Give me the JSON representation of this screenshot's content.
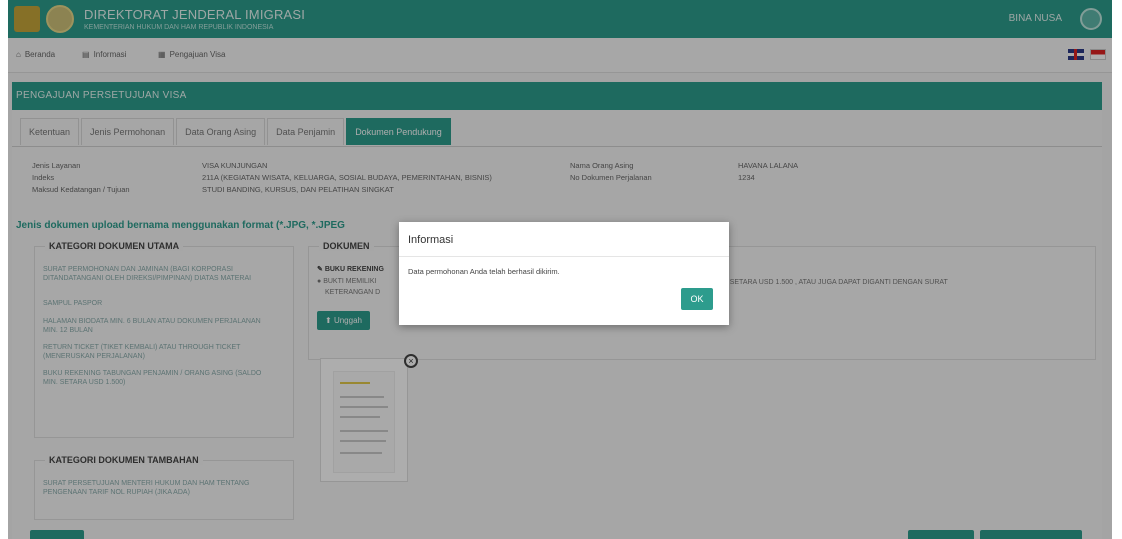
{
  "brand": {
    "title": "DIREKTORAT JENDERAL IMIGRASI",
    "subtitle": "KEMENTERIAN HUKUM DAN HAM REPUBLIK INDONESIA"
  },
  "user": {
    "name": "BINA NUSA"
  },
  "nav": [
    {
      "label": "Beranda",
      "icon": "home-icon"
    },
    {
      "label": "Informasi",
      "icon": "book-icon"
    },
    {
      "label": "Pengajuan Visa",
      "icon": "table-icon"
    }
  ],
  "panel": {
    "title": "PENGAJUAN PERSETUJUAN VISA"
  },
  "tabs": [
    {
      "label": "Ketentuan"
    },
    {
      "label": "Jenis Permohonan"
    },
    {
      "label": "Data Orang Asing"
    },
    {
      "label": "Data Penjamin"
    },
    {
      "label": "Dokumen Pendukung",
      "active": true
    }
  ],
  "info_left": {
    "labels": [
      "Jenis Layanan",
      "Indeks",
      "Maksud Kedatangan / Tujuan"
    ],
    "values": [
      "VISA KUNJUNGAN",
      "211A  (KEGIATAN WISATA, KELUARGA, SOSIAL BUDAYA, PEMERINTAHAN, BISNIS)",
      "STUDI BANDING, KURSUS, DAN PELATIHAN SINGKAT"
    ]
  },
  "info_right": {
    "labels": [
      "Nama Orang Asing",
      "No Dokumen Perjalanan"
    ],
    "values": [
      "HAVANA LALANA",
      "1234"
    ]
  },
  "note": "Jenis dokumen upload bernama menggunakan format (*.JPG, *.JPEG",
  "kategori_utama": {
    "title": "KATEGORI DOKUMEN UTAMA",
    "items": [
      "SURAT PERMOHONAN DAN JAMINAN (BAGI KORPORASI DITANDATANGANI OLEH DIREKSI/PIMPINAN) DIATAS MATERAI",
      "SAMPUL PASPOR",
      "HALAMAN BIODATA MIN. 6 BULAN ATAU DOKUMEN PERJALANAN MIN. 12 BULAN",
      "RETURN TICKET (TIKET KEMBALI) ATAU THROUGH TICKET (MENERUSKAN PERJALANAN)",
      "BUKU REKENING TABUNGAN PENJAMIN / ORANG ASING (SALDO MIN. SETARA USD 1.500)"
    ]
  },
  "kategori_tambahan": {
    "title": "KATEGORI DOKUMEN TAMBAHAN",
    "items": [
      "SURAT PERSETUJUAN MENTERI HUKUM DAN HAM TENTANG PENGENAAN TARIF NOL RUPIAH (JIKA ADA)"
    ]
  },
  "dokumen": {
    "title": "DOKUMEN",
    "bullet1": "BUKU REKENING",
    "bullet2a": "BUKTI MEMILIKI",
    "bullet2b": "KETERANGAN D",
    "right_text": "MIN. SETARA USD 1.500 , ATAU JUGA DAPAT DIGANTI DENGAN SURAT",
    "upload_label": "Unggah"
  },
  "modal": {
    "title": "Informasi",
    "message": "Data permohonan Anda telah berhasil dikirim.",
    "ok_label": "OK"
  },
  "colors": {
    "primary": "#2d9c8d",
    "overlay": "rgba(0,0,0,0.32)"
  }
}
